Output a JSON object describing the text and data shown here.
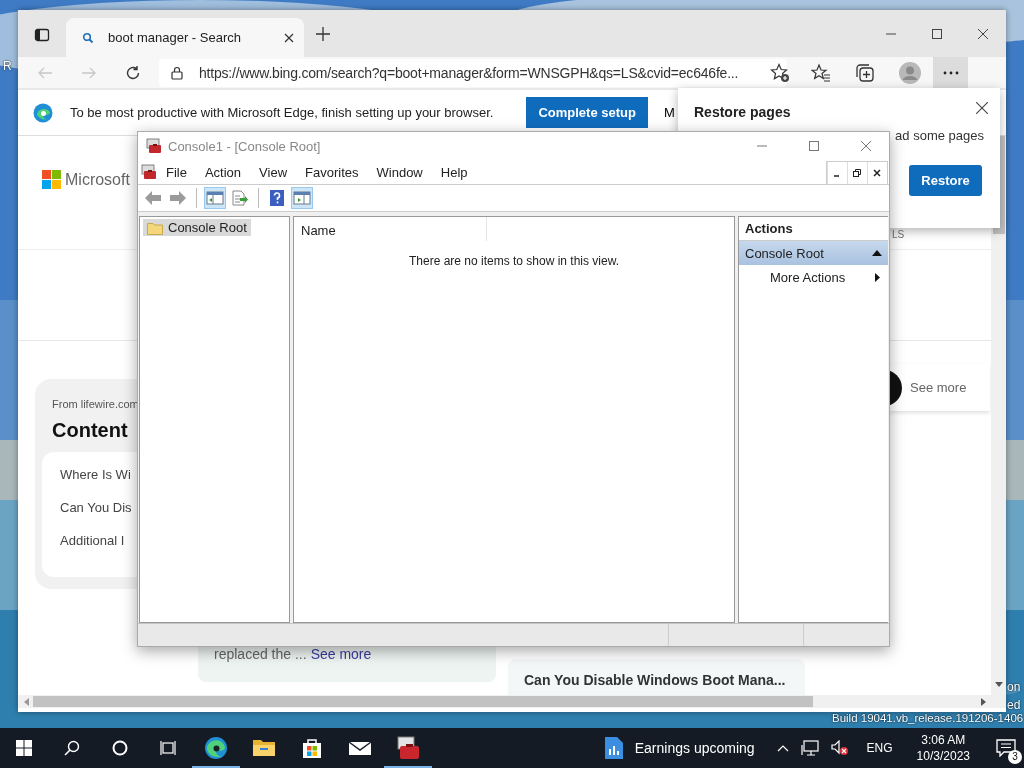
{
  "desktop": {
    "kind": "picture",
    "fragments": [
      "R",
      "on",
      "ed"
    ],
    "build": "Build 19041.vb_release.191206-1406"
  },
  "browser": {
    "tab": {
      "title": "boot manager - Search",
      "selected": true
    },
    "url": "https://www.bing.com/search?q=boot+manager&form=WNSGPH&qs=LS&cvid=ec646fe...",
    "infobar": {
      "message": "To be most productive with Microsoft Edge, finish setting up your browser.",
      "button": "Complete setup",
      "second_button": "M"
    },
    "page": {
      "logo": "Microsoft",
      "scope_label": "LS",
      "source": "From lifewire.com",
      "heading": "Content",
      "toc": [
        "Where Is Wi",
        "Can You Dis",
        "Additional I"
      ],
      "snippet": "replaced the ...",
      "snippet_link": "See more",
      "side_link": "See more",
      "card_title": "Can You Disable Windows Boot Mana..."
    }
  },
  "restore_popup": {
    "title": "Restore pages",
    "message": "ad some pages",
    "button": "Restore"
  },
  "console": {
    "title": "Console1 - [Console Root]",
    "menu": [
      "File",
      "Action",
      "View",
      "Favorites",
      "Window",
      "Help"
    ],
    "toolbar": [
      {
        "kind": "back",
        "pressed": false
      },
      {
        "kind": "forward",
        "pressed": false
      },
      {
        "kind": "separator"
      },
      {
        "kind": "tree",
        "pressed": true
      },
      {
        "kind": "export",
        "pressed": false
      },
      {
        "kind": "separator"
      },
      {
        "kind": "help",
        "pressed": false
      },
      {
        "kind": "action-pane",
        "pressed": true
      }
    ],
    "tree": [
      {
        "label": "Console Root",
        "selected": true
      }
    ],
    "columns": [
      "Name"
    ],
    "empty_message": "There are no items to show in this view.",
    "actions": {
      "title": "Actions",
      "section": {
        "label": "Console Root",
        "expanded": true
      },
      "items": [
        "More Actions"
      ]
    }
  },
  "taskbar": {
    "apps": [
      {
        "kind": "edge",
        "running": true
      },
      {
        "kind": "explorer",
        "running": false
      },
      {
        "kind": "store",
        "running": false
      },
      {
        "kind": "mail",
        "running": false
      },
      {
        "kind": "toolbox",
        "running": true
      }
    ],
    "news": "Earnings upcoming",
    "language": "ENG",
    "time": "3:06 AM",
    "date": "10/3/2023",
    "notifications": "3"
  }
}
